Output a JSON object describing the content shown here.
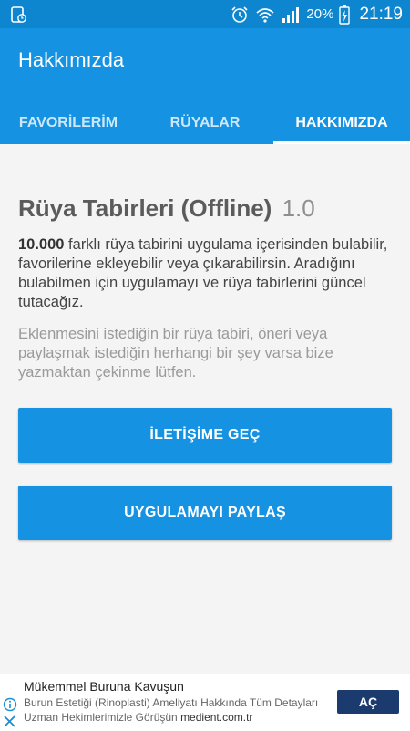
{
  "status_bar": {
    "battery": "20%",
    "time": "21:19",
    "icons": [
      "sim-card-icon",
      "alarm-icon",
      "wifi-icon",
      "signal-icon",
      "battery-charging-icon"
    ]
  },
  "app_bar": {
    "title": "Hakkımızda"
  },
  "tabs": [
    {
      "label": "FAVORİLERİM",
      "active": false
    },
    {
      "label": "RÜYALAR",
      "active": false
    },
    {
      "label": "HAKKIMIZDA",
      "active": true
    }
  ],
  "about": {
    "title": "Rüya Tabirleri (Offline)",
    "version": "1.0",
    "para1_bold": "10.000",
    "para1_rest": " farklı rüya tabirini uygulama içerisinden bulabilir, favorilerine ekleyebilir veya çıkarabilirsin. Aradığını bulabilmen için uygulamayı ve rüya tabirlerini güncel tutacağız.",
    "para2": "Eklenmesini istediğin bir rüya tabiri, öneri veya paylaşmak istediğin herhangi bir şey varsa bize yazmaktan çekinme lütfen."
  },
  "buttons": {
    "contact": "İLETİŞİME GEÇ",
    "share": "UYGULAMAYI PAYLAŞ"
  },
  "ad": {
    "title": "Mükemmel Buruna Kavuşun",
    "body": "Burun Estetiği (Rinoplasti) Ameliyatı Hakkında Tüm Detayları Uzman Hekimlerimizle Görüşün",
    "domain": "medient.com.tr",
    "cta": "AÇ"
  },
  "colors": {
    "status_bar": "#0e86cf",
    "primary": "#1592e2",
    "ad_button": "#1b3b6f"
  }
}
